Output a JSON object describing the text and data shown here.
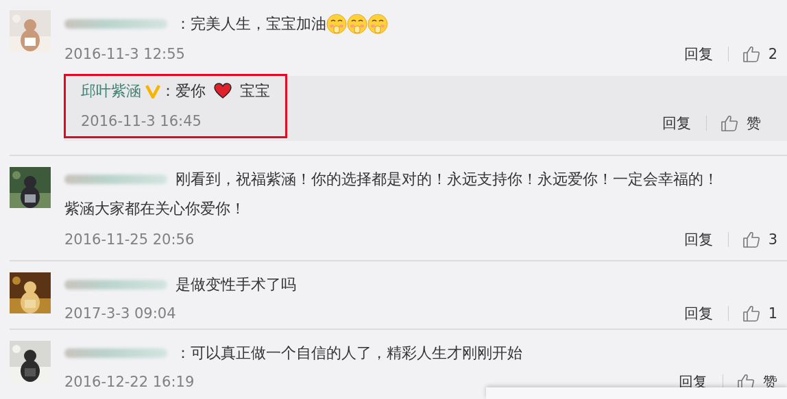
{
  "comments": [
    {
      "avatar": {
        "kind": "picture"
      },
      "author_blurred": true,
      "lines": [
        [
          {
            "kind": "text",
            "text": "：完美人生，宝宝加油"
          },
          {
            "kind": "emoji"
          },
          {
            "kind": "emoji"
          },
          {
            "kind": "emoji"
          }
        ]
      ],
      "time": "2016-11-3 12:55",
      "reply_label": "回复",
      "like_label": "2",
      "replies": [
        {
          "name": "邱叶紫涵",
          "verified": true,
          "highlighted": true,
          "parts": [
            {
              "kind": "text",
              "text": "：爱你"
            },
            {
              "kind": "heart"
            },
            {
              "kind": "text",
              "text": "宝宝"
            }
          ],
          "time": "2016-11-3 16:45",
          "reply_label": "回复",
          "like_label": "赞"
        }
      ]
    },
    {
      "avatar": {
        "kind": "picture"
      },
      "author_blurred": true,
      "lines": [
        [
          {
            "kind": "text",
            "text": "刚看到，祝福紫涵！你的选择都是对的！永远支持你！永远爱你！一定会幸福的！"
          }
        ],
        [
          {
            "kind": "text",
            "text": "紫涵大家都在关心你爱你！"
          }
        ]
      ],
      "time": "2016-11-25 20:56",
      "reply_label": "回复",
      "like_label": "3"
    },
    {
      "avatar": {
        "kind": "picture"
      },
      "author_blurred": true,
      "lines": [
        [
          {
            "kind": "text",
            "text": "是做变性手术了吗"
          }
        ]
      ],
      "time": "2017-3-3 09:04",
      "reply_label": "回复",
      "like_label": "1"
    },
    {
      "avatar": {
        "kind": "picture"
      },
      "author_blurred": true,
      "lines": [
        [
          {
            "kind": "text",
            "text": "：可以真正做一个自信的人了，精彩人生才刚刚开始"
          }
        ]
      ],
      "time": "2016-12-22 16:19",
      "reply_label": "回复",
      "like_label": "赞"
    }
  ]
}
